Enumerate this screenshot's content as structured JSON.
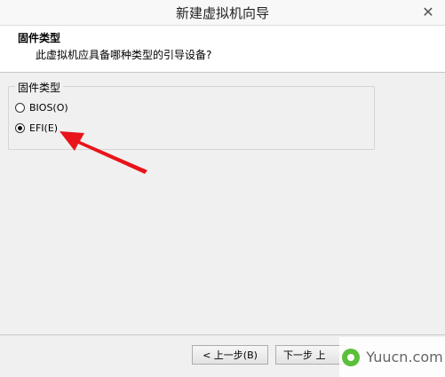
{
  "window": {
    "title": "新建虚拟机向导",
    "close_glyph": "✕"
  },
  "header": {
    "title": "固件类型",
    "subtitle": "此虚拟机应具备哪种类型的引导设备?"
  },
  "firmware_group": {
    "legend": "固件类型",
    "options": [
      {
        "label": "BIOS(O)",
        "selected": false
      },
      {
        "label": "EFI(E)",
        "selected": true
      }
    ]
  },
  "annotation": {
    "arrow_color": "#e8141a"
  },
  "buttons": {
    "back_label": "< 上一步(B)",
    "next_label": "下一步",
    "next_partial": "上"
  },
  "watermark": {
    "text": "Yuucn.com"
  }
}
